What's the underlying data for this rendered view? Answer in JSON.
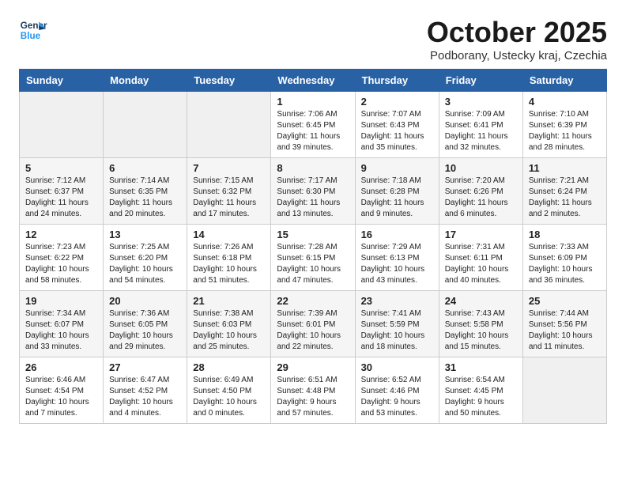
{
  "header": {
    "logo_line1": "General",
    "logo_line2": "Blue",
    "month": "October 2025",
    "location": "Podborany, Ustecky kraj, Czechia"
  },
  "weekdays": [
    "Sunday",
    "Monday",
    "Tuesday",
    "Wednesday",
    "Thursday",
    "Friday",
    "Saturday"
  ],
  "weeks": [
    [
      {
        "day": "",
        "info": ""
      },
      {
        "day": "",
        "info": ""
      },
      {
        "day": "",
        "info": ""
      },
      {
        "day": "1",
        "info": "Sunrise: 7:06 AM\nSunset: 6:45 PM\nDaylight: 11 hours\nand 39 minutes."
      },
      {
        "day": "2",
        "info": "Sunrise: 7:07 AM\nSunset: 6:43 PM\nDaylight: 11 hours\nand 35 minutes."
      },
      {
        "day": "3",
        "info": "Sunrise: 7:09 AM\nSunset: 6:41 PM\nDaylight: 11 hours\nand 32 minutes."
      },
      {
        "day": "4",
        "info": "Sunrise: 7:10 AM\nSunset: 6:39 PM\nDaylight: 11 hours\nand 28 minutes."
      }
    ],
    [
      {
        "day": "5",
        "info": "Sunrise: 7:12 AM\nSunset: 6:37 PM\nDaylight: 11 hours\nand 24 minutes."
      },
      {
        "day": "6",
        "info": "Sunrise: 7:14 AM\nSunset: 6:35 PM\nDaylight: 11 hours\nand 20 minutes."
      },
      {
        "day": "7",
        "info": "Sunrise: 7:15 AM\nSunset: 6:32 PM\nDaylight: 11 hours\nand 17 minutes."
      },
      {
        "day": "8",
        "info": "Sunrise: 7:17 AM\nSunset: 6:30 PM\nDaylight: 11 hours\nand 13 minutes."
      },
      {
        "day": "9",
        "info": "Sunrise: 7:18 AM\nSunset: 6:28 PM\nDaylight: 11 hours\nand 9 minutes."
      },
      {
        "day": "10",
        "info": "Sunrise: 7:20 AM\nSunset: 6:26 PM\nDaylight: 11 hours\nand 6 minutes."
      },
      {
        "day": "11",
        "info": "Sunrise: 7:21 AM\nSunset: 6:24 PM\nDaylight: 11 hours\nand 2 minutes."
      }
    ],
    [
      {
        "day": "12",
        "info": "Sunrise: 7:23 AM\nSunset: 6:22 PM\nDaylight: 10 hours\nand 58 minutes."
      },
      {
        "day": "13",
        "info": "Sunrise: 7:25 AM\nSunset: 6:20 PM\nDaylight: 10 hours\nand 54 minutes."
      },
      {
        "day": "14",
        "info": "Sunrise: 7:26 AM\nSunset: 6:18 PM\nDaylight: 10 hours\nand 51 minutes."
      },
      {
        "day": "15",
        "info": "Sunrise: 7:28 AM\nSunset: 6:15 PM\nDaylight: 10 hours\nand 47 minutes."
      },
      {
        "day": "16",
        "info": "Sunrise: 7:29 AM\nSunset: 6:13 PM\nDaylight: 10 hours\nand 43 minutes."
      },
      {
        "day": "17",
        "info": "Sunrise: 7:31 AM\nSunset: 6:11 PM\nDaylight: 10 hours\nand 40 minutes."
      },
      {
        "day": "18",
        "info": "Sunrise: 7:33 AM\nSunset: 6:09 PM\nDaylight: 10 hours\nand 36 minutes."
      }
    ],
    [
      {
        "day": "19",
        "info": "Sunrise: 7:34 AM\nSunset: 6:07 PM\nDaylight: 10 hours\nand 33 minutes."
      },
      {
        "day": "20",
        "info": "Sunrise: 7:36 AM\nSunset: 6:05 PM\nDaylight: 10 hours\nand 29 minutes."
      },
      {
        "day": "21",
        "info": "Sunrise: 7:38 AM\nSunset: 6:03 PM\nDaylight: 10 hours\nand 25 minutes."
      },
      {
        "day": "22",
        "info": "Sunrise: 7:39 AM\nSunset: 6:01 PM\nDaylight: 10 hours\nand 22 minutes."
      },
      {
        "day": "23",
        "info": "Sunrise: 7:41 AM\nSunset: 5:59 PM\nDaylight: 10 hours\nand 18 minutes."
      },
      {
        "day": "24",
        "info": "Sunrise: 7:43 AM\nSunset: 5:58 PM\nDaylight: 10 hours\nand 15 minutes."
      },
      {
        "day": "25",
        "info": "Sunrise: 7:44 AM\nSunset: 5:56 PM\nDaylight: 10 hours\nand 11 minutes."
      }
    ],
    [
      {
        "day": "26",
        "info": "Sunrise: 6:46 AM\nSunset: 4:54 PM\nDaylight: 10 hours\nand 7 minutes."
      },
      {
        "day": "27",
        "info": "Sunrise: 6:47 AM\nSunset: 4:52 PM\nDaylight: 10 hours\nand 4 minutes."
      },
      {
        "day": "28",
        "info": "Sunrise: 6:49 AM\nSunset: 4:50 PM\nDaylight: 10 hours\nand 0 minutes."
      },
      {
        "day": "29",
        "info": "Sunrise: 6:51 AM\nSunset: 4:48 PM\nDaylight: 9 hours\nand 57 minutes."
      },
      {
        "day": "30",
        "info": "Sunrise: 6:52 AM\nSunset: 4:46 PM\nDaylight: 9 hours\nand 53 minutes."
      },
      {
        "day": "31",
        "info": "Sunrise: 6:54 AM\nSunset: 4:45 PM\nDaylight: 9 hours\nand 50 minutes."
      },
      {
        "day": "",
        "info": ""
      }
    ]
  ]
}
